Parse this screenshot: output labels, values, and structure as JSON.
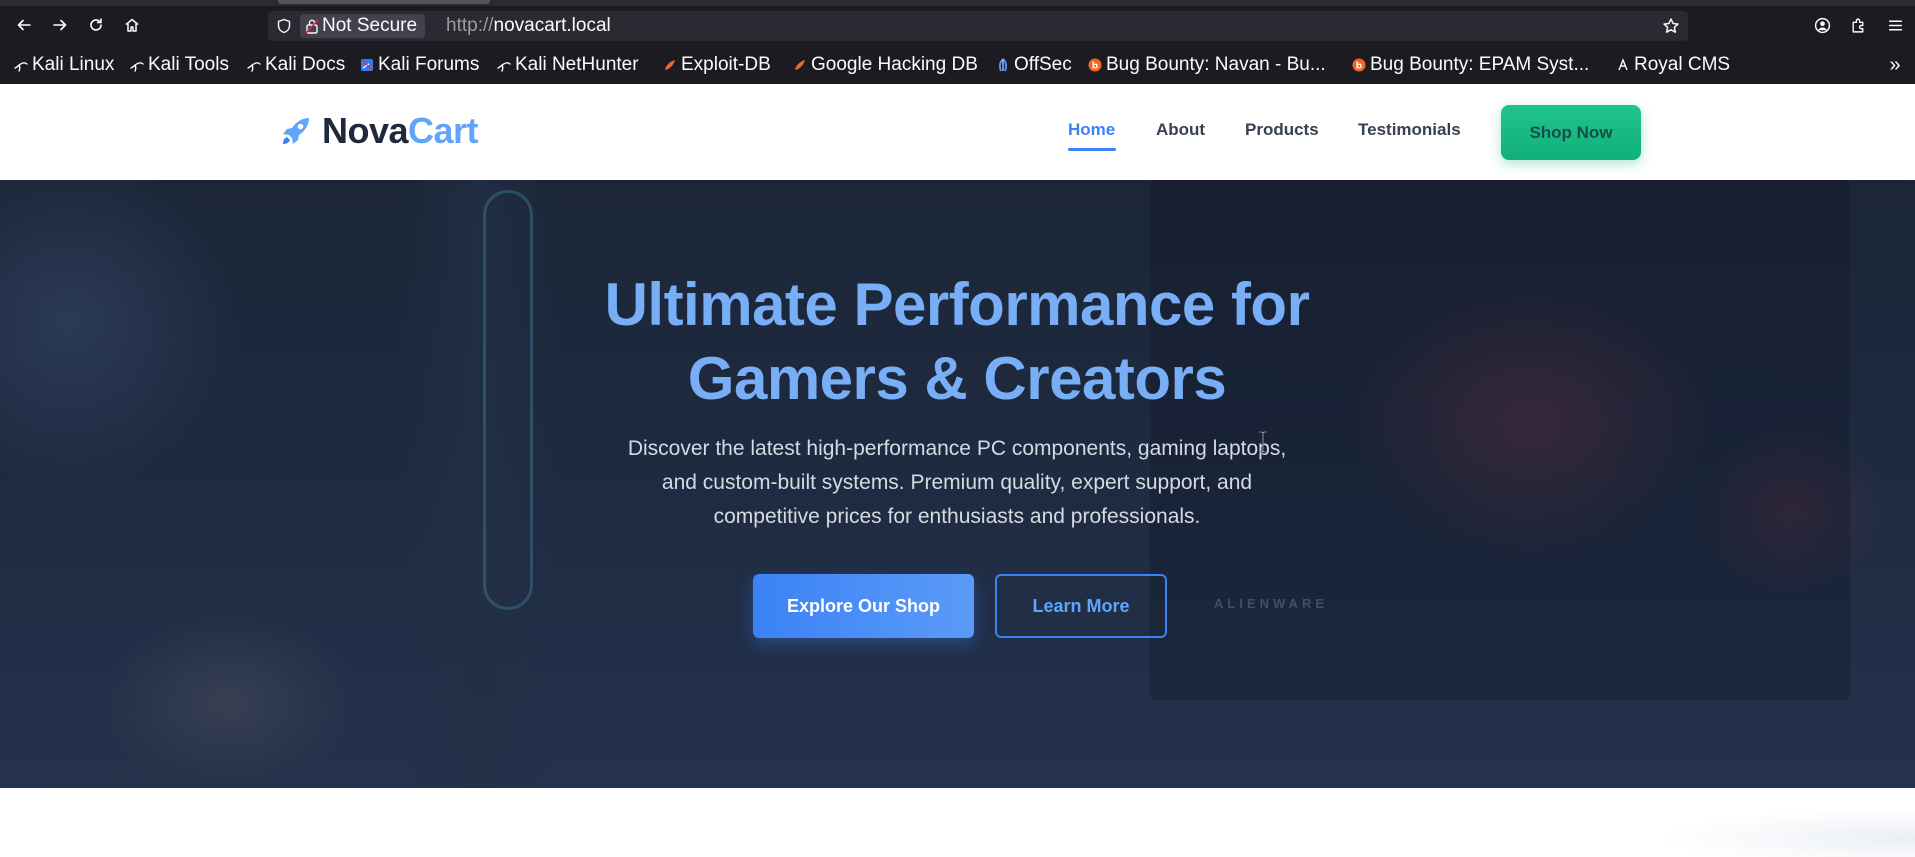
{
  "browser": {
    "url_scheme": "http://",
    "url_host": "novacart.local",
    "security_label": "Not Secure",
    "bookmarks": [
      {
        "label": "Kali Linux",
        "icon": "kali-dragon-icon"
      },
      {
        "label": "Kali Tools",
        "icon": "kali-dragon-icon"
      },
      {
        "label": "Kali Docs",
        "icon": "kali-dragon-icon"
      },
      {
        "label": "Kali Forums",
        "icon": "kali-forums-icon"
      },
      {
        "label": "Kali NetHunter",
        "icon": "kali-dragon-icon"
      },
      {
        "label": "Exploit-DB",
        "icon": "exploit-db-icon"
      },
      {
        "label": "Google Hacking DB",
        "icon": "exploit-db-icon"
      },
      {
        "label": "OffSec",
        "icon": "offsec-icon"
      },
      {
        "label": "Bug Bounty: Navan - Bu...",
        "icon": "bugcrowd-icon"
      },
      {
        "label": "Bug Bounty: EPAM Syst...",
        "icon": "bugcrowd-icon"
      },
      {
        "label": "Royal CMS",
        "icon": "royal-cms-icon"
      }
    ]
  },
  "site": {
    "logo_part1": "Nova",
    "logo_part2": "Cart",
    "nav": [
      {
        "label": "Home",
        "active": true
      },
      {
        "label": "About",
        "active": false
      },
      {
        "label": "Products",
        "active": false
      },
      {
        "label": "Testimonials",
        "active": false
      }
    ],
    "cta_label": "Shop Now"
  },
  "hero": {
    "title_line1": "Ultimate Performance for",
    "title_line2": "Gamers & Creators",
    "subtitle_line1": "Discover the latest high-performance PC components, gaming laptops,",
    "subtitle_line2": "and custom-built systems. Premium quality, expert support, and",
    "subtitle_line3": "competitive prices for enthusiasts and professionals.",
    "primary_button": "Explore Our Shop",
    "secondary_button": "Learn More",
    "watermark": "ALIENWARE"
  },
  "colors": {
    "accent_blue": "#3b82f6",
    "title_blue": "#77aef5",
    "cta_green": "#10b981",
    "hero_bg": "#1e2a40"
  }
}
